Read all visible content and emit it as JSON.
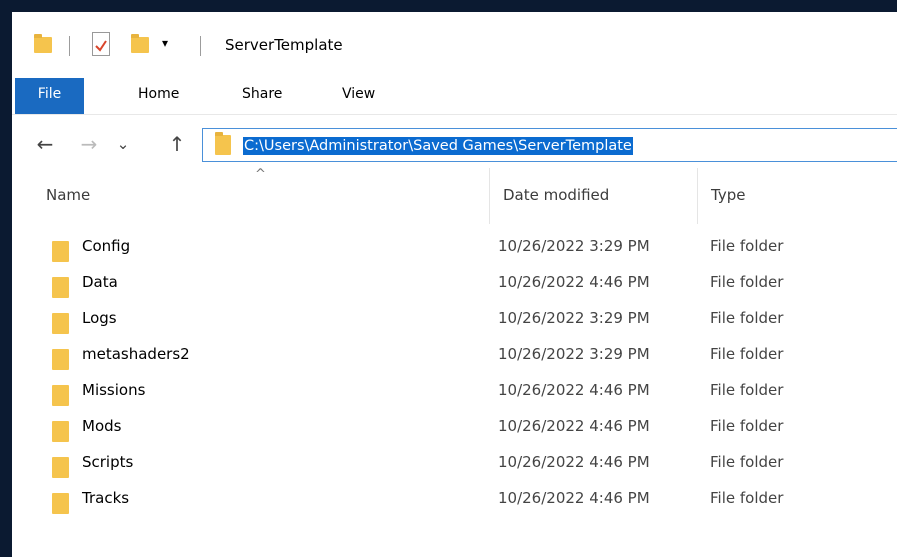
{
  "window": {
    "title": "ServerTemplate"
  },
  "ribbon": {
    "tabs": [
      "File",
      "Home",
      "Share",
      "View"
    ]
  },
  "nav": {
    "back_glyph": "←",
    "forward_glyph": "→",
    "recent_glyph": "⌄",
    "up_glyph": "↑",
    "address": "C:\\Users\\Administrator\\Saved Games\\ServerTemplate"
  },
  "columns": {
    "name": "Name",
    "date": "Date modified",
    "type": "Type",
    "sort_glyph": "^"
  },
  "items": [
    {
      "name": "Config",
      "date": "10/26/2022 3:29 PM",
      "type": "File folder"
    },
    {
      "name": "Data",
      "date": "10/26/2022 4:46 PM",
      "type": "File folder"
    },
    {
      "name": "Logs",
      "date": "10/26/2022 3:29 PM",
      "type": "File folder"
    },
    {
      "name": "metashaders2",
      "date": "10/26/2022 3:29 PM",
      "type": "File folder"
    },
    {
      "name": "Missions",
      "date": "10/26/2022 4:46 PM",
      "type": "File folder"
    },
    {
      "name": "Mods",
      "date": "10/26/2022 4:46 PM",
      "type": "File folder"
    },
    {
      "name": "Scripts",
      "date": "10/26/2022 4:46 PM",
      "type": "File folder"
    },
    {
      "name": "Tracks",
      "date": "10/26/2022 4:46 PM",
      "type": "File folder"
    }
  ],
  "colors": {
    "accent": "#1a6ac1",
    "selection": "#0b6bd0",
    "folder": "#f5c44d"
  }
}
